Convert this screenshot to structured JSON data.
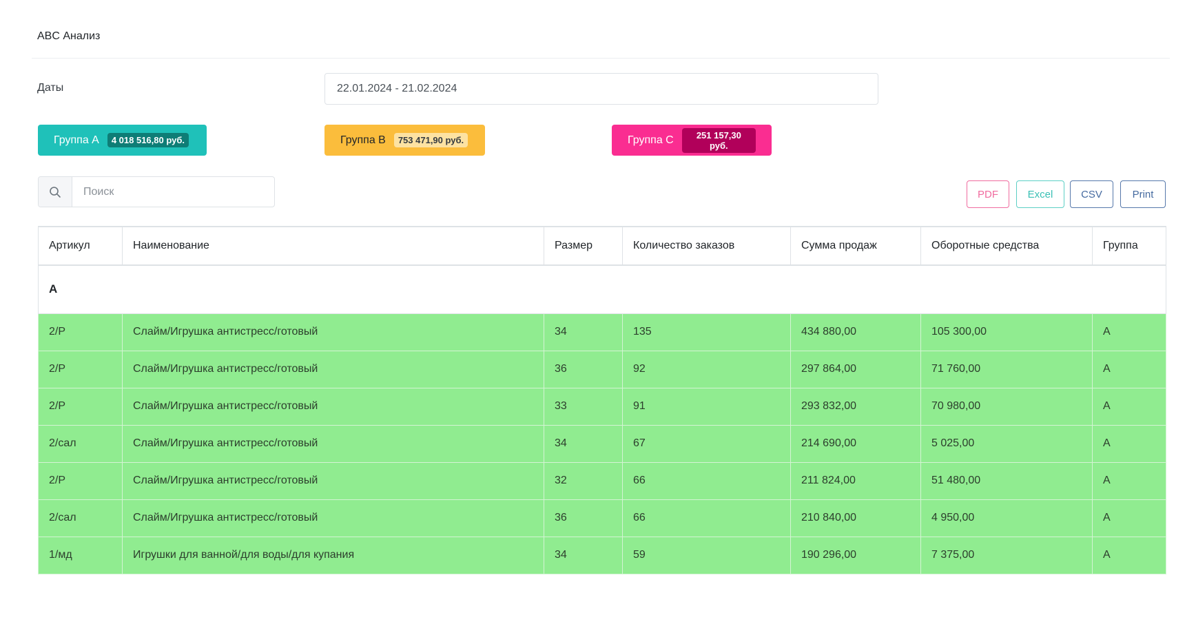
{
  "page": {
    "title": "ABC Анализ"
  },
  "filters": {
    "dates_label": "Даты",
    "date_range": "22.01.2024 - 21.02.2024"
  },
  "groups": [
    {
      "label": "Группа А",
      "amount": "4 018 516,80 руб.",
      "color": "#1fc1b9"
    },
    {
      "label": "Группа В",
      "amount": "753 471,90 руб.",
      "color": "#fbbd3c"
    },
    {
      "label": "Группа С",
      "amount": "251 157,30 руб.",
      "color": "#fa2d91"
    }
  ],
  "search": {
    "placeholder": "Поиск",
    "icon": "search-icon"
  },
  "export": {
    "pdf": "PDF",
    "excel": "Excel",
    "csv": "CSV",
    "print": "Print"
  },
  "table": {
    "headers": [
      "Артикул",
      "Наименование",
      "Размер",
      "Количество заказов",
      "Сумма продаж",
      "Оборотные средства",
      "Группа"
    ],
    "group_label": "A",
    "row_color": "#90ec90",
    "rows": [
      [
        "2/Р",
        "Слайм/Игрушка антистресс/готовый",
        "34",
        "135",
        "434 880,00",
        "105 300,00",
        "A"
      ],
      [
        "2/Р",
        "Слайм/Игрушка антистресс/готовый",
        "36",
        "92",
        "297 864,00",
        "71 760,00",
        "A"
      ],
      [
        "2/Р",
        "Слайм/Игрушка антистресс/готовый",
        "33",
        "91",
        "293 832,00",
        "70 980,00",
        "A"
      ],
      [
        "2/сал",
        "Слайм/Игрушка антистресс/готовый",
        "34",
        "67",
        "214 690,00",
        "5 025,00",
        "A"
      ],
      [
        "2/Р",
        "Слайм/Игрушка антистресс/готовый",
        "32",
        "66",
        "211 824,00",
        "51 480,00",
        "A"
      ],
      [
        "2/сал",
        "Слайм/Игрушка антистресс/готовый",
        "36",
        "66",
        "210 840,00",
        "4 950,00",
        "A"
      ],
      [
        "1/мд",
        "Игрушки для ванной/для воды/для купания",
        "34",
        "59",
        "190 296,00",
        "7 375,00",
        "A"
      ]
    ]
  }
}
